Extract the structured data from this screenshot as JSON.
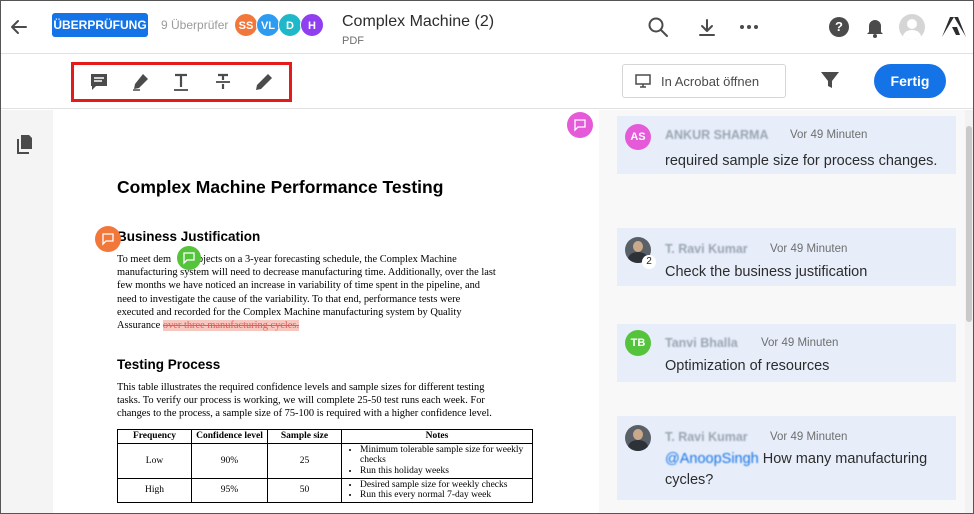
{
  "header": {
    "review_badge": "ÜBERPRÜFUNG",
    "reviewers_label": "9 Überprüfer",
    "avatars": [
      {
        "initials": "SS",
        "color": "#f2773b"
      },
      {
        "initials": "VL",
        "color": "#2d9cf0"
      },
      {
        "initials": "D",
        "color": "#1fb8c8"
      },
      {
        "initials": "H",
        "color": "#8f3ef0"
      }
    ],
    "title": "Complex Machine (2)",
    "file_type": "PDF"
  },
  "toolbar": {
    "open_in_acrobat": "In Acrobat öffnen",
    "done": "Fertig"
  },
  "document": {
    "title": "Complex Machine Performance Testing",
    "section1_heading": "Business Justification",
    "section1_lines": [
      "To meet dem      r objects on a 3-year forecasting schedule, the Complex Machine",
      "manufacturing system will need to decrease manufacturing time. Additionally, over the last",
      "few months we have noticed an increase in variability of time spent in the pipeline, and",
      "need to investigate the cause of the variability. To that end, performance tests were",
      "executed and recorded for the Complex Machine manufacturing system by Quality"
    ],
    "section1_last_prefix": "Assurance ",
    "section1_struck": "over three manufacturing cycles.",
    "section2_heading": "Testing Process",
    "section2_lines": [
      "This table illustrates the required confidence levels and sample sizes for different testing",
      "tasks. To verify our process is working, we will complete 25-50 test runs each week. For",
      "changes to the process, a sample size of 75-100 is required with a higher confidence level."
    ],
    "table": {
      "headers": [
        "Frequency",
        "Confidence level",
        "Sample size",
        "Notes"
      ],
      "rows": [
        {
          "frequency": "Low",
          "confidence": "90%",
          "sample": "25",
          "notes": [
            "Minimum tolerable sample size for weekly checks",
            "Run this holiday weeks"
          ]
        },
        {
          "frequency": "High",
          "confidence": "95%",
          "sample": "50",
          "notes": [
            "Desired sample size for weekly checks",
            "Run this every normal 7-day week"
          ]
        }
      ]
    }
  },
  "comments": [
    {
      "initials": "AS",
      "color": "#e45ad8",
      "name": "ANKUR SHARMA",
      "time": "Vor 49 Minuten",
      "message": "required sample size for process changes."
    },
    {
      "name": "T. Ravi Kumar",
      "time": "Vor 49 Minuten",
      "message": "Check the business justification",
      "count": "2"
    },
    {
      "initials": "TB",
      "color": "#55c43c",
      "name": "Tanvi Bhalla",
      "time": "Vor 49 Minuten",
      "message": "Optimization of resources"
    },
    {
      "name": "T. Ravi Kumar",
      "time": "Vor 49 Minuten",
      "mention": "@AnoopSingh",
      "message": " How many manufacturing cycles?"
    }
  ]
}
